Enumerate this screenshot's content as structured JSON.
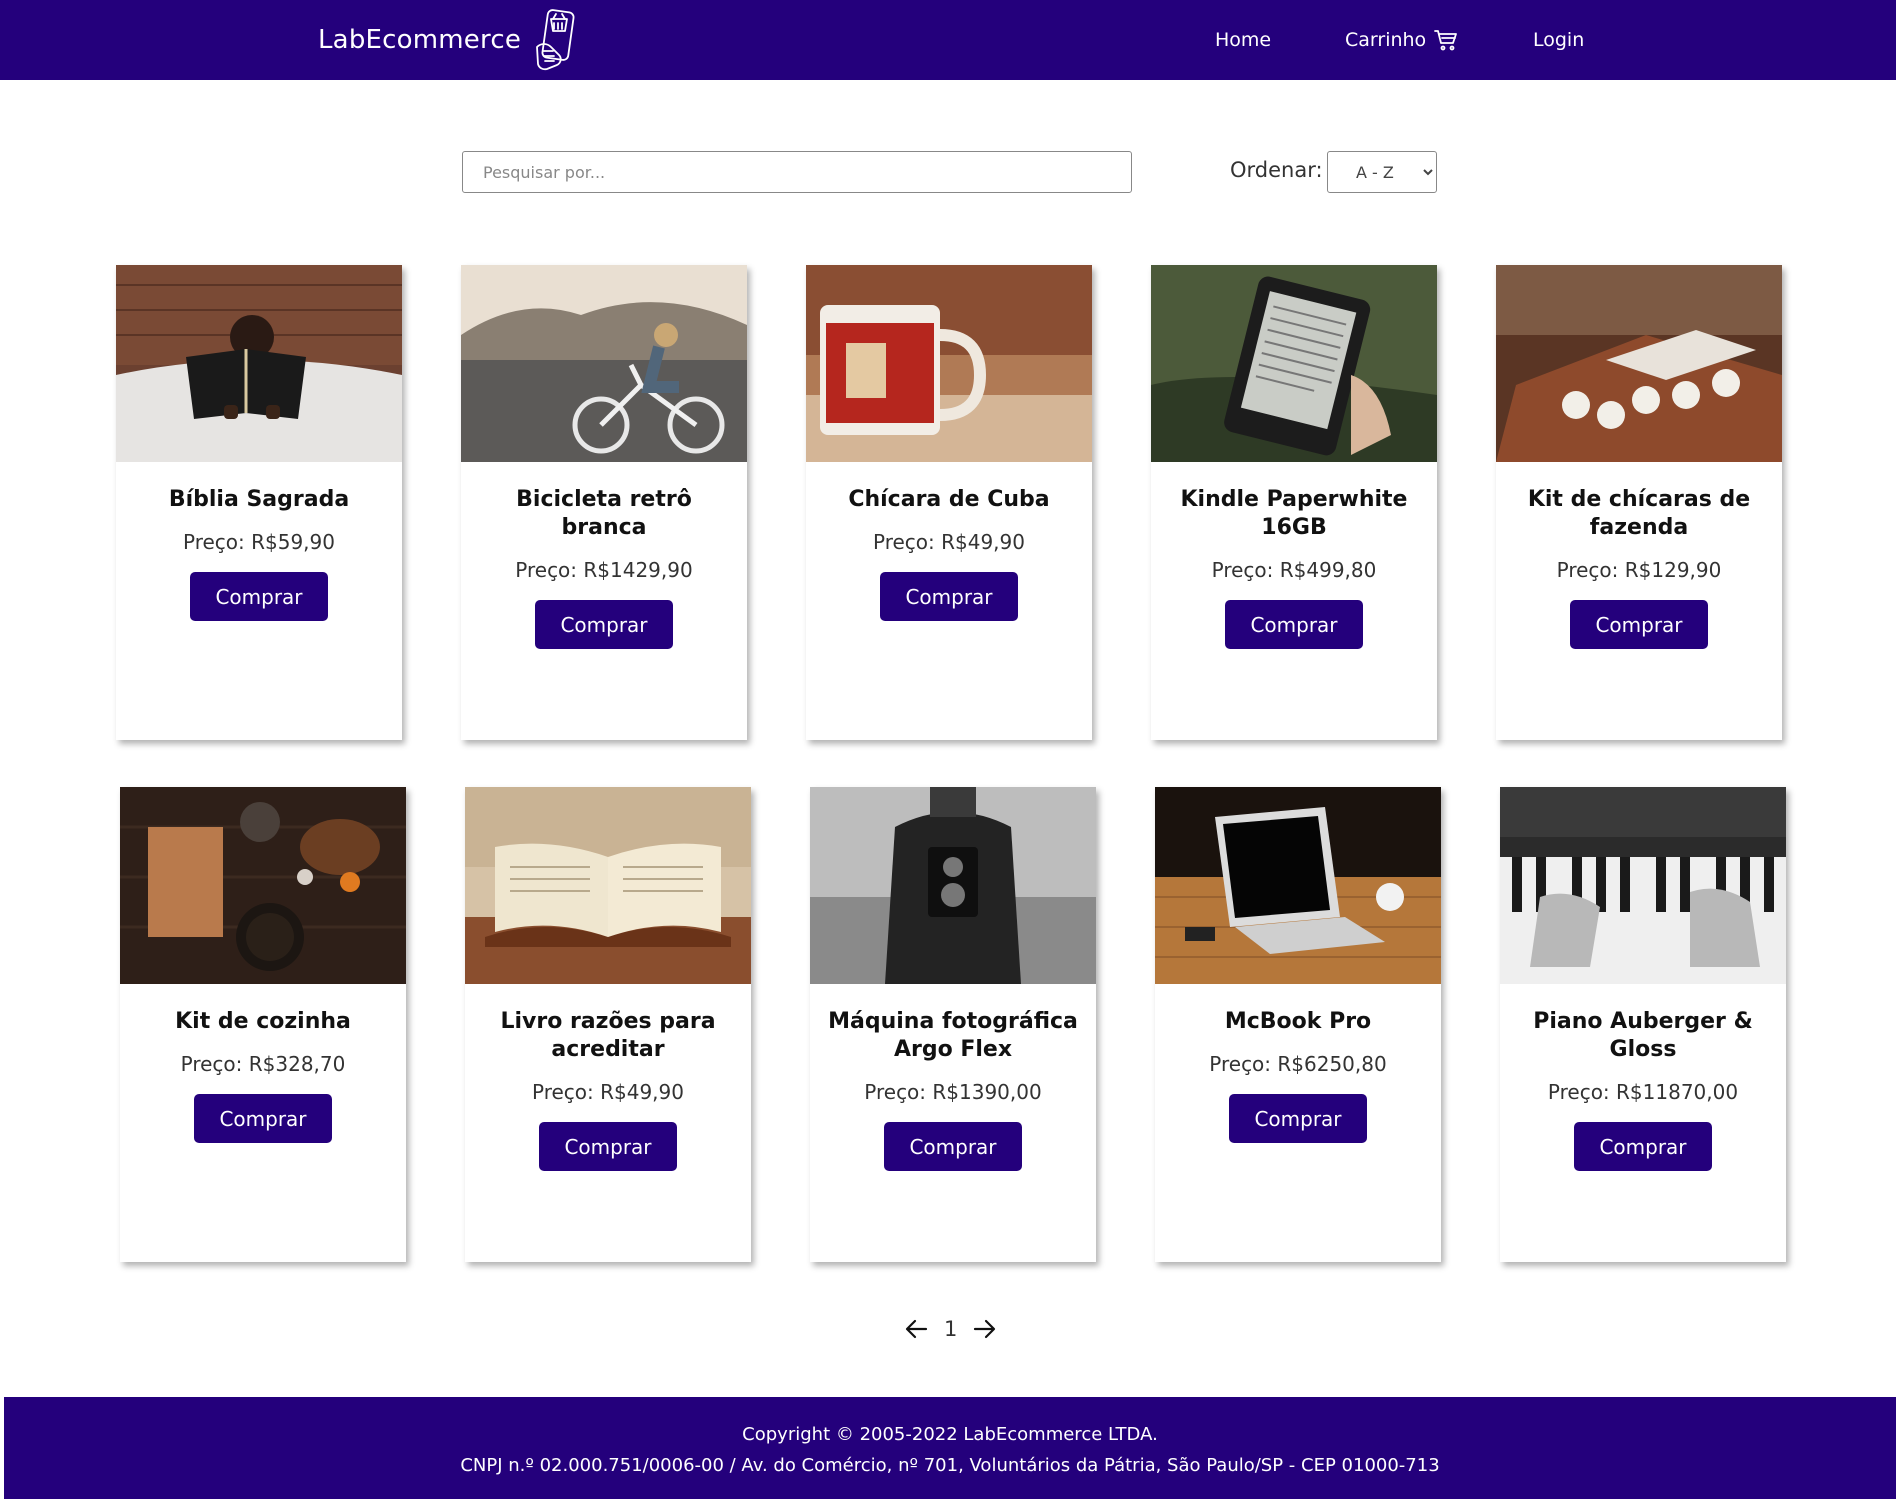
{
  "header": {
    "brand": "LabEcommerce",
    "nav": {
      "home": "Home",
      "cart": "Carrinho",
      "login": "Login"
    },
    "bg_color": "#24007c"
  },
  "search": {
    "placeholder": "Pesquisar por...",
    "value": ""
  },
  "sort": {
    "label": "Ordenar:",
    "selected": "A - Z"
  },
  "products": [
    {
      "name": "Bíblia Sagrada",
      "price": "Preço: R$59,90",
      "button": "Comprar",
      "image_icon": "bible-photo"
    },
    {
      "name": "Bicicleta retrô branca",
      "price": "Preço: R$1429,90",
      "button": "Comprar",
      "image_icon": "bicycle-photo"
    },
    {
      "name": "Chícara de Cuba",
      "price": "Preço: R$49,90",
      "button": "Comprar",
      "image_icon": "mug-photo"
    },
    {
      "name": "Kindle Paperwhite 16GB",
      "price": "Preço: R$499,80",
      "button": "Comprar",
      "image_icon": "kindle-photo"
    },
    {
      "name": "Kit de chícaras de fazenda",
      "price": "Preço: R$129,90",
      "button": "Comprar",
      "image_icon": "cups-photo"
    },
    {
      "name": "Kit de cozinha",
      "price": "Preço: R$328,70",
      "button": "Comprar",
      "image_icon": "kitchen-photo"
    },
    {
      "name": "Livro razões para acreditar",
      "price": "Preço: R$49,90",
      "button": "Comprar",
      "image_icon": "book-photo"
    },
    {
      "name": "Máquina fotográfica Argo Flex",
      "price": "Preço: R$1390,00",
      "button": "Comprar",
      "image_icon": "camera-photo"
    },
    {
      "name": "McBook Pro",
      "price": "Preço: R$6250,80",
      "button": "Comprar",
      "image_icon": "laptop-photo"
    },
    {
      "name": "Piano Auberger & Gloss",
      "price": "Preço: R$11870,00",
      "button": "Comprar",
      "image_icon": "piano-photo"
    }
  ],
  "pagination": {
    "current": "1"
  },
  "footer": {
    "line1": "Copyright © 2005-2022 LabEcommerce LTDA.",
    "line2": "CNPJ n.º 02.000.751/0006-00 / Av. do Comércio, nº 701, Voluntários da Pátria, São Paulo/SP - CEP 01000-713"
  }
}
